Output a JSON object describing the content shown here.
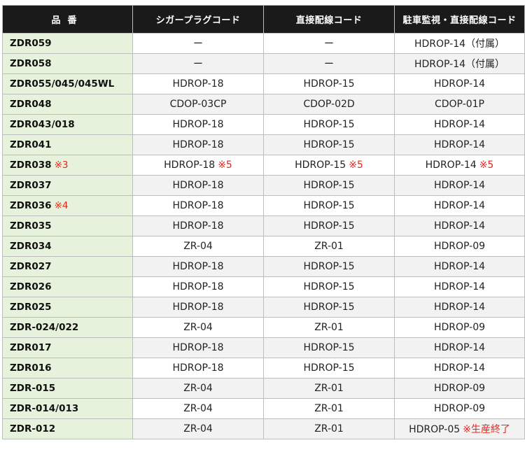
{
  "header": {
    "model": "品番",
    "cigar": "シガープラグコード",
    "direct": "直接配線コード",
    "parking": "駐車監視・直接配線コード"
  },
  "rows": [
    {
      "model": "ZDR059",
      "model_note": "",
      "cigar": "ー",
      "cigar_note": "",
      "direct": "ー",
      "direct_note": "",
      "parking": "HDROP-14（付属）",
      "parking_note": ""
    },
    {
      "model": "ZDR058",
      "model_note": "",
      "cigar": "ー",
      "cigar_note": "",
      "direct": "ー",
      "direct_note": "",
      "parking": "HDROP-14（付属）",
      "parking_note": ""
    },
    {
      "model": "ZDR055/045/045WL",
      "model_note": "",
      "cigar": "HDROP-18",
      "cigar_note": "",
      "direct": "HDROP-15",
      "direct_note": "",
      "parking": "HDROP-14",
      "parking_note": ""
    },
    {
      "model": "ZDR048",
      "model_note": "",
      "cigar": "CDOP-03CP",
      "cigar_note": "",
      "direct": "CDOP-02D",
      "direct_note": "",
      "parking": "CDOP-01P",
      "parking_note": ""
    },
    {
      "model": "ZDR043/018",
      "model_note": "",
      "cigar": "HDROP-18",
      "cigar_note": "",
      "direct": "HDROP-15",
      "direct_note": "",
      "parking": "HDROP-14",
      "parking_note": ""
    },
    {
      "model": "ZDR041",
      "model_note": "",
      "cigar": "HDROP-18",
      "cigar_note": "",
      "direct": "HDROP-15",
      "direct_note": "",
      "parking": "HDROP-14",
      "parking_note": ""
    },
    {
      "model": "ZDR038",
      "model_note": "※3",
      "cigar": "HDROP-18",
      "cigar_note": "※5",
      "direct": "HDROP-15",
      "direct_note": "※5",
      "parking": "HDROP-14",
      "parking_note": "※5"
    },
    {
      "model": "ZDR037",
      "model_note": "",
      "cigar": "HDROP-18",
      "cigar_note": "",
      "direct": "HDROP-15",
      "direct_note": "",
      "parking": "HDROP-14",
      "parking_note": ""
    },
    {
      "model": "ZDR036",
      "model_note": "※4",
      "cigar": "HDROP-18",
      "cigar_note": "",
      "direct": "HDROP-15",
      "direct_note": "",
      "parking": "HDROP-14",
      "parking_note": ""
    },
    {
      "model": "ZDR035",
      "model_note": "",
      "cigar": "HDROP-18",
      "cigar_note": "",
      "direct": "HDROP-15",
      "direct_note": "",
      "parking": "HDROP-14",
      "parking_note": ""
    },
    {
      "model": "ZDR034",
      "model_note": "",
      "cigar": "ZR-04",
      "cigar_note": "",
      "direct": "ZR-01",
      "direct_note": "",
      "parking": "HDROP-09",
      "parking_note": ""
    },
    {
      "model": "ZDR027",
      "model_note": "",
      "cigar": "HDROP-18",
      "cigar_note": "",
      "direct": "HDROP-15",
      "direct_note": "",
      "parking": "HDROP-14",
      "parking_note": ""
    },
    {
      "model": "ZDR026",
      "model_note": "",
      "cigar": "HDROP-18",
      "cigar_note": "",
      "direct": "HDROP-15",
      "direct_note": "",
      "parking": "HDROP-14",
      "parking_note": ""
    },
    {
      "model": "ZDR025",
      "model_note": "",
      "cigar": "HDROP-18",
      "cigar_note": "",
      "direct": "HDROP-15",
      "direct_note": "",
      "parking": "HDROP-14",
      "parking_note": ""
    },
    {
      "model": "ZDR-024/022",
      "model_note": "",
      "cigar": "ZR-04",
      "cigar_note": "",
      "direct": "ZR-01",
      "direct_note": "",
      "parking": "HDROP-09",
      "parking_note": ""
    },
    {
      "model": "ZDR017",
      "model_note": "",
      "cigar": "HDROP-18",
      "cigar_note": "",
      "direct": "HDROP-15",
      "direct_note": "",
      "parking": "HDROP-14",
      "parking_note": ""
    },
    {
      "model": "ZDR016",
      "model_note": "",
      "cigar": "HDROP-18",
      "cigar_note": "",
      "direct": "HDROP-15",
      "direct_note": "",
      "parking": "HDROP-14",
      "parking_note": ""
    },
    {
      "model": "ZDR-015",
      "model_note": "",
      "cigar": "ZR-04",
      "cigar_note": "",
      "direct": "ZR-01",
      "direct_note": "",
      "parking": "HDROP-09",
      "parking_note": ""
    },
    {
      "model": "ZDR-014/013",
      "model_note": "",
      "cigar": "ZR-04",
      "cigar_note": "",
      "direct": "ZR-01",
      "direct_note": "",
      "parking": "HDROP-09",
      "parking_note": ""
    },
    {
      "model": "ZDR-012",
      "model_note": "",
      "cigar": "ZR-04",
      "cigar_note": "",
      "direct": "ZR-01",
      "direct_note": "",
      "parking": "HDROP-05",
      "parking_note": "※生産終了"
    }
  ],
  "colors": {
    "header_bg": "#1a1a1a",
    "model_bg": "#e7f2dc",
    "note": "#e8251c",
    "row_alt": "#f2f2f2",
    "border": "#bdbdbd"
  }
}
